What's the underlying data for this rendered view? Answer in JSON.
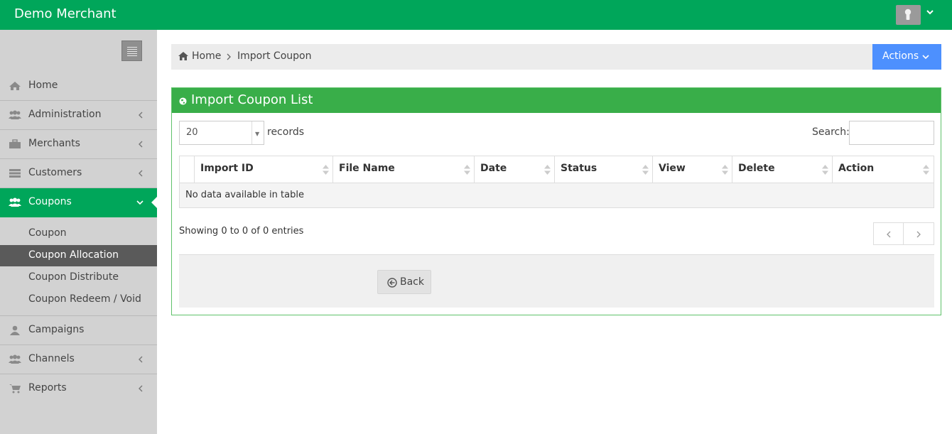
{
  "header": {
    "brand": "Demo Merchant",
    "user_menu_icon": "chevron-down-icon",
    "avatar_icon": "user-avatar-icon"
  },
  "sidebar": {
    "toggle_icon": "hamburger-menu-icon",
    "items": [
      {
        "label": "Home",
        "icon": "home-icon",
        "has_submenu": false
      },
      {
        "label": "Administration",
        "icon": "users-icon",
        "has_submenu": true
      },
      {
        "label": "Merchants",
        "icon": "briefcase-icon",
        "has_submenu": true
      },
      {
        "label": "Customers",
        "icon": "list-icon",
        "has_submenu": true
      },
      {
        "label": "Coupons",
        "icon": "users-icon",
        "has_submenu": true,
        "active": true
      },
      {
        "label": "Campaigns",
        "icon": "user-icon",
        "has_submenu": false
      },
      {
        "label": "Channels",
        "icon": "users-icon",
        "has_submenu": true
      },
      {
        "label": "Reports",
        "icon": "cart-icon",
        "has_submenu": true
      }
    ],
    "coupon_submenu": [
      {
        "label": "Coupon"
      },
      {
        "label": "Coupon Allocation",
        "active": true
      },
      {
        "label": "Coupon Distribute"
      },
      {
        "label": "Coupon Redeem / Void"
      }
    ]
  },
  "breadcrumb": {
    "home": "Home",
    "current": "Import Coupon"
  },
  "actions_button": {
    "label": "Actions"
  },
  "panel": {
    "title": "Import Coupon List",
    "page_length": "20",
    "records_label": "records",
    "search_label": "Search:",
    "search_value": "",
    "columns": [
      "Import ID",
      "File Name",
      "Date",
      "Status",
      "View",
      "Delete",
      "Action"
    ],
    "empty_message": "No data available in table",
    "info": "Showing 0 to 0 of 0 entries",
    "back_label": "Back"
  },
  "colors": {
    "brand_green": "#00a65a",
    "panel_header_green": "#39ae49",
    "actions_blue": "#4d90fe",
    "active_submenu": "#5a5a5a",
    "sidebar_bg": "#d2d2d2"
  }
}
